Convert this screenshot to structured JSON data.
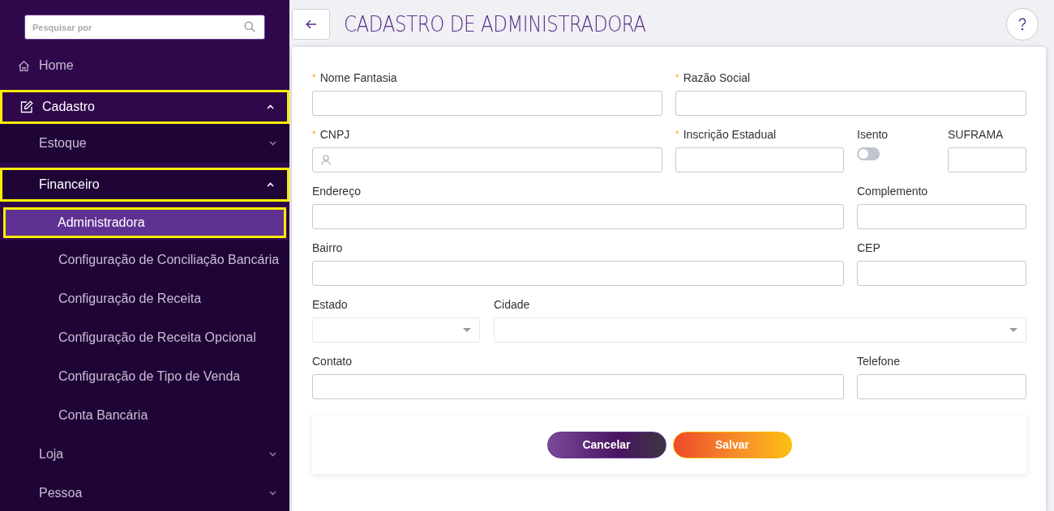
{
  "sidebar": {
    "search": {
      "placeholder": "Pesquisar por"
    },
    "items": [
      {
        "label": "Home",
        "selected": false,
        "highlighted": false
      },
      {
        "label": "Cadastro",
        "expanded": true,
        "selected": false,
        "highlighted": true,
        "children": [
          {
            "label": "Estoque",
            "expanded": false,
            "selected": false,
            "highlighted": false
          },
          {
            "label": "Financeiro",
            "expanded": true,
            "selected": false,
            "highlighted": true,
            "children": [
              {
                "label": "Administradora",
                "selected": true,
                "highlighted": true
              },
              {
                "label": "Configuração de Conciliação Bancária",
                "selected": false,
                "highlighted": false
              },
              {
                "label": "Configuração de Receita",
                "selected": false,
                "highlighted": false
              },
              {
                "label": "Configuração de Receita Opcional",
                "selected": false,
                "highlighted": false
              },
              {
                "label": "Configuração de Tipo de Venda",
                "selected": false,
                "highlighted": false
              },
              {
                "label": "Conta Bancária",
                "selected": false,
                "highlighted": false
              }
            ]
          },
          {
            "label": "Loja",
            "expanded": false,
            "selected": false,
            "highlighted": false
          },
          {
            "label": "Pessoa",
            "expanded": false,
            "selected": false,
            "highlighted": false
          }
        ]
      }
    ]
  },
  "header": {
    "title": "CADASTRO DE ADMINISTRADORA"
  },
  "form": {
    "rows": [
      [
        {
          "label": "Nome Fantasia",
          "required_mark": "*",
          "kind": "text"
        },
        {
          "label": "Razão Social",
          "required_mark": "*",
          "kind": "text"
        }
      ],
      [
        {
          "label": "CNPJ",
          "required_mark": "*",
          "kind": "user"
        },
        {
          "label": "Inscrição Estadual",
          "required_mark": "*",
          "kind": "text"
        },
        {
          "label": "Isento",
          "kind": "toggle",
          "on": false
        },
        {
          "label": "SUFRAMA",
          "kind": "text"
        }
      ],
      [
        {
          "label": "Endereço",
          "kind": "text"
        },
        {
          "label": "Complemento",
          "kind": "text"
        }
      ],
      [
        {
          "label": "Bairro",
          "kind": "text"
        },
        {
          "label": "CEP",
          "kind": "text"
        }
      ],
      [
        {
          "label": "Estado",
          "kind": "select"
        },
        {
          "label": "Cidade",
          "kind": "select"
        }
      ],
      [
        {
          "label": "Contato",
          "kind": "text"
        },
        {
          "label": "Telefone",
          "kind": "text"
        }
      ]
    ]
  },
  "actions": [
    {
      "label": "Cancelar",
      "kind": "cancel"
    },
    {
      "label": "Salvar",
      "kind": "save"
    }
  ]
}
